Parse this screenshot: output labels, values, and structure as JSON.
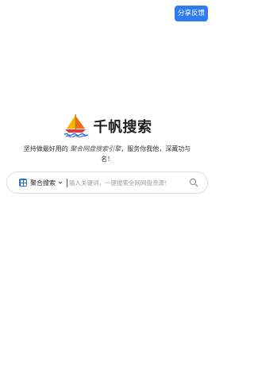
{
  "header": {
    "feedback_label": "分享反馈"
  },
  "brand": {
    "name": "千帆搜索"
  },
  "slogan": {
    "part1": "坚持做最好用的 ",
    "emphasis": "聚合网盘搜索引擎",
    "part2": "，服务你我他，深藏功与名！"
  },
  "search": {
    "engine_label": "聚合搜索",
    "placeholder": "输入关键词，一键搜索全网网盘资源！",
    "value": ""
  },
  "icons": {
    "logo": "sailboat-logo",
    "engine": "grid-apps-icon",
    "dropdown": "chevron-down-icon",
    "search": "search-icon"
  },
  "colors": {
    "accent": "#2f7bf2",
    "sail_yellow": "#f7b500",
    "sail_orange": "#f26a1b",
    "hull_red": "#e8382f",
    "wave_blue": "#2f6be9"
  }
}
